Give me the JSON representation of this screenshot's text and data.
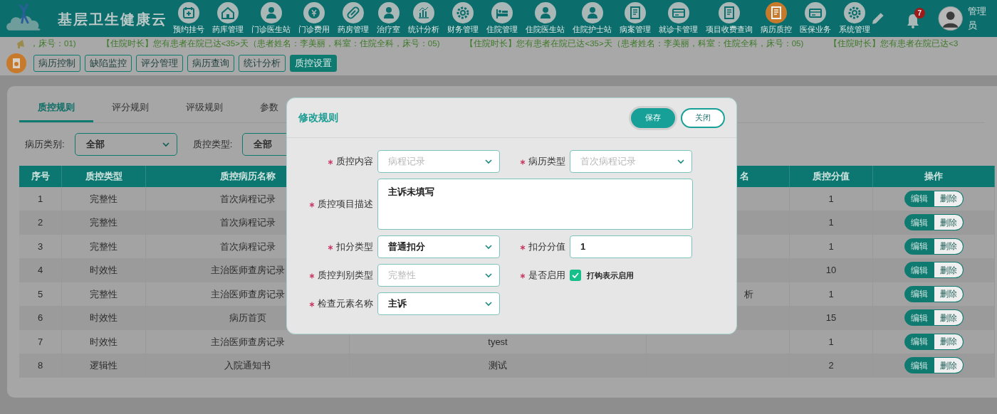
{
  "header": {
    "title": "基层卫生健康云",
    "nav": [
      {
        "label": "预约挂号",
        "selected": false
      },
      {
        "label": "药库管理",
        "selected": false
      },
      {
        "label": "门诊医生站",
        "selected": false
      },
      {
        "label": "门诊费用",
        "selected": false
      },
      {
        "label": "药房管理",
        "selected": false
      },
      {
        "label": "治疗室",
        "selected": false
      },
      {
        "label": "统计分析",
        "selected": false
      },
      {
        "label": "财务管理",
        "selected": false
      },
      {
        "label": "住院管理",
        "selected": false
      },
      {
        "label": "住院医生站",
        "selected": false
      },
      {
        "label": "住院护士站",
        "selected": false
      },
      {
        "label": "病案管理",
        "selected": false
      },
      {
        "label": "就诊卡管理",
        "selected": false
      },
      {
        "label": "项目收费查询",
        "selected": false
      },
      {
        "label": "病历质控",
        "selected": true
      },
      {
        "label": "医保业务",
        "selected": false
      },
      {
        "label": "系统管理",
        "selected": false
      }
    ],
    "notifications": "7",
    "user": "管理员"
  },
  "marquee": [
    "，床号：01)",
    "【住院时长】您有患者在院已达<35>天（患者姓名：李美丽，科室：住院全科，床号：05)",
    "【住院时长】您有患者在院已达<35>天（患者姓名：李美丽，科室：住院全科，床号：05)",
    "【住院时长】您有患者在院已达<3"
  ],
  "toolbar": [
    {
      "label": "病历控制",
      "selected": false
    },
    {
      "label": "缺陷监控",
      "selected": false
    },
    {
      "label": "评分管理",
      "selected": false
    },
    {
      "label": "病历查询",
      "selected": false
    },
    {
      "label": "统计分析",
      "selected": false
    },
    {
      "label": "质控设置",
      "selected": true
    }
  ],
  "tabs": [
    {
      "label": "质控规则",
      "selected": true
    },
    {
      "label": "评分规则",
      "selected": false
    },
    {
      "label": "评级规则",
      "selected": false
    },
    {
      "label": "参数",
      "selected": false
    }
  ],
  "filters": [
    {
      "label": "病历类别:",
      "value": "全部"
    },
    {
      "label": "质控类型:",
      "value": "全部"
    }
  ],
  "table": {
    "columns": [
      "序号",
      "质控类型",
      "质控病历名称",
      "名",
      "质控分值",
      "操作"
    ],
    "rows": [
      {
        "no": "1",
        "type": "完整性",
        "record": "首次病程记录",
        "score": "1",
        "actions": [
          "编辑",
          "删除"
        ]
      },
      {
        "no": "2",
        "type": "完整性",
        "record": "首次病程记录",
        "score": "1",
        "actions": [
          "编辑",
          "删除"
        ]
      },
      {
        "no": "3",
        "type": "完整性",
        "record": "首次病程记录",
        "score": "1",
        "actions": [
          "编辑",
          "删除"
        ]
      },
      {
        "no": "4",
        "type": "时效性",
        "record": "主治医师查房记录",
        "score": "10",
        "actions": [
          "编辑",
          "删除"
        ]
      },
      {
        "no": "5",
        "type": "完整性",
        "record": "主治医师查房记录",
        "column_5": "析",
        "score": "1",
        "actions": [
          "编辑",
          "删除"
        ]
      },
      {
        "no": "6",
        "type": "时效性",
        "record": "病历首页",
        "score": "15",
        "actions": [
          "编辑",
          "删除"
        ]
      },
      {
        "no": "7",
        "type": "时效性",
        "record": "主治医师查房记录",
        "column_4": "tyest",
        "score": "1",
        "actions": [
          "编辑",
          "删除"
        ]
      },
      {
        "no": "8",
        "type": "逻辑性",
        "record": "入院通知书",
        "column_4": "测试",
        "score": "2",
        "actions": [
          "编辑",
          "删除"
        ]
      }
    ]
  },
  "modal": {
    "title": "修改规则",
    "buttons": [
      {
        "label": "保存",
        "primary": true
      },
      {
        "label": "关闭",
        "primary": false
      }
    ],
    "fields": [
      {
        "kind": "select",
        "label": "质控内容",
        "required": true,
        "value": "病程记录",
        "disabled": true
      },
      {
        "kind": "select",
        "label": "病历类型",
        "required": true,
        "value": "首次病程记录",
        "disabled": true
      },
      {
        "kind": "textarea",
        "label": "质控项目描述",
        "required": true,
        "value": "主诉未填写",
        "disabled": false
      },
      {
        "kind": "select",
        "label": "扣分类型",
        "required": true,
        "value": "普通扣分",
        "disabled": false
      },
      {
        "kind": "input",
        "label": "扣分分值",
        "required": true,
        "value": "1",
        "disabled": false
      },
      {
        "kind": "select",
        "label": "质控判别类型",
        "required": true,
        "value": "完整性",
        "disabled": true
      },
      {
        "kind": "checkbox",
        "label": "是否启用",
        "required": true,
        "text": "打钩表示启用",
        "checked": true
      },
      {
        "kind": "select",
        "label": "检查元素名称",
        "required": true,
        "value": "主诉",
        "disabled": false
      }
    ]
  }
}
